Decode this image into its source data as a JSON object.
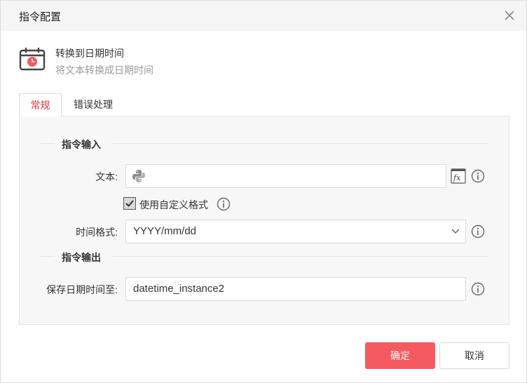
{
  "dialog": {
    "title": "指令配置"
  },
  "command": {
    "name": "转换到日期时间",
    "description": "将文本转换成日期时间",
    "icon": "calendar-clock-icon"
  },
  "tabs": [
    {
      "label": "常规",
      "active": true
    },
    {
      "label": "错误处理",
      "active": false
    }
  ],
  "sections": {
    "input_title": "指令输入",
    "output_title": "指令输出"
  },
  "fields": {
    "text": {
      "label": "文本:",
      "value": "",
      "prefix_icon": "python-icon"
    },
    "custom_format": {
      "label": "使用自定义格式",
      "checked": true
    },
    "time_format": {
      "label": "时间格式:",
      "value": "YYYY/mm/dd"
    },
    "save_to": {
      "label": "保存日期时间至:",
      "value": "datetime_instance2"
    }
  },
  "buttons": {
    "ok": "确定",
    "cancel": "取消"
  },
  "colors": {
    "accent": "#f45a5f",
    "active_tab": "#e0343e",
    "panel_bg": "#f7f7f7",
    "titlebar_bg": "#f5f5f5"
  }
}
